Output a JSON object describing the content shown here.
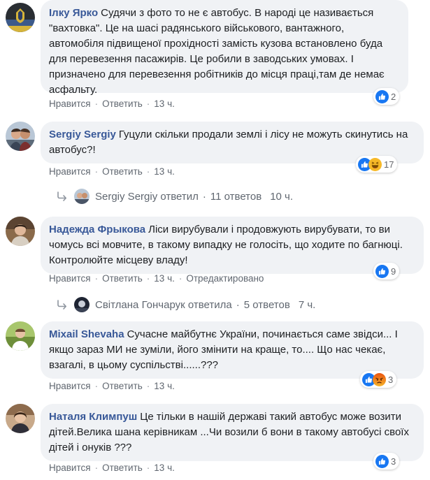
{
  "action_labels": {
    "like": "Нравится",
    "reply": "Ответить",
    "edited": "Отредактировано"
  },
  "separator": "·",
  "colors": {
    "author_link": "#385898",
    "bubble_bg": "#f0f2f5",
    "meta_text": "#606770",
    "like_blue": "#1877f2",
    "haha_yellow": "#f7b928",
    "angry_orange": "#e9710f"
  },
  "comments": [
    {
      "author": "Ілку Ярко",
      "text": "Судячи з фото то не є автобус. В народі це називається \"вахтовка\". Це на шасі радянського військового, вантажного, автомобіля підвищеної прохідності замість кузова встановлено буда для перевезення пасажирів. Це робили в заводських умовах. І призначено для перевезення робітників до місця праці,там де немає асфальту.",
      "time": "13 ч.",
      "reactions": {
        "icons": [
          "like-icon"
        ],
        "count": "2"
      }
    },
    {
      "author": "Sergiy Sergiy",
      "text": "Гуцули скільки продали землі і лісу не можуть скинутись на автобус?!",
      "time": "13 ч.",
      "reactions": {
        "icons": [
          "like-icon",
          "haha-icon"
        ],
        "count": "17"
      },
      "replies": {
        "who": "Sergiy Sergiy ответил",
        "count": "11 ответов",
        "time": "10 ч."
      }
    },
    {
      "author": "Надежда Фрыкова",
      "text": "Ліси вирубували і продовжують вирубувати, то ви чомусь всі мовчите, в такому випадку не голосіть, що ходите по багнюці. Контролюйте місцеву владу!",
      "time": "13 ч.",
      "edited": true,
      "reactions": {
        "icons": [
          "like-icon"
        ],
        "count": "9"
      },
      "replies": {
        "who": "Світлана Гончарук ответила",
        "count": "5 ответов",
        "time": "7 ч."
      }
    },
    {
      "author": "Mixail Shevaha",
      "text": "Сучасне майбутнє України, починається саме звідси... І якщо зараз МИ не зуміли, його змінити на краще, то.... Що нас чекає, взагалі, в цьому суспільстві......???",
      "time": "13 ч.",
      "reactions": {
        "icons": [
          "like-icon",
          "angry-icon"
        ],
        "count": "3"
      }
    },
    {
      "author": "Наталя Климпуш",
      "text": "Це тільки в нашій державі такий автобус може возити дітей.Велика шана керівникам ...Чи возили б вони в такому автобусі своїх дітей і онуків ???",
      "time": "13 ч.",
      "reactions": {
        "icons": [
          "like-icon"
        ],
        "count": "3"
      }
    }
  ]
}
